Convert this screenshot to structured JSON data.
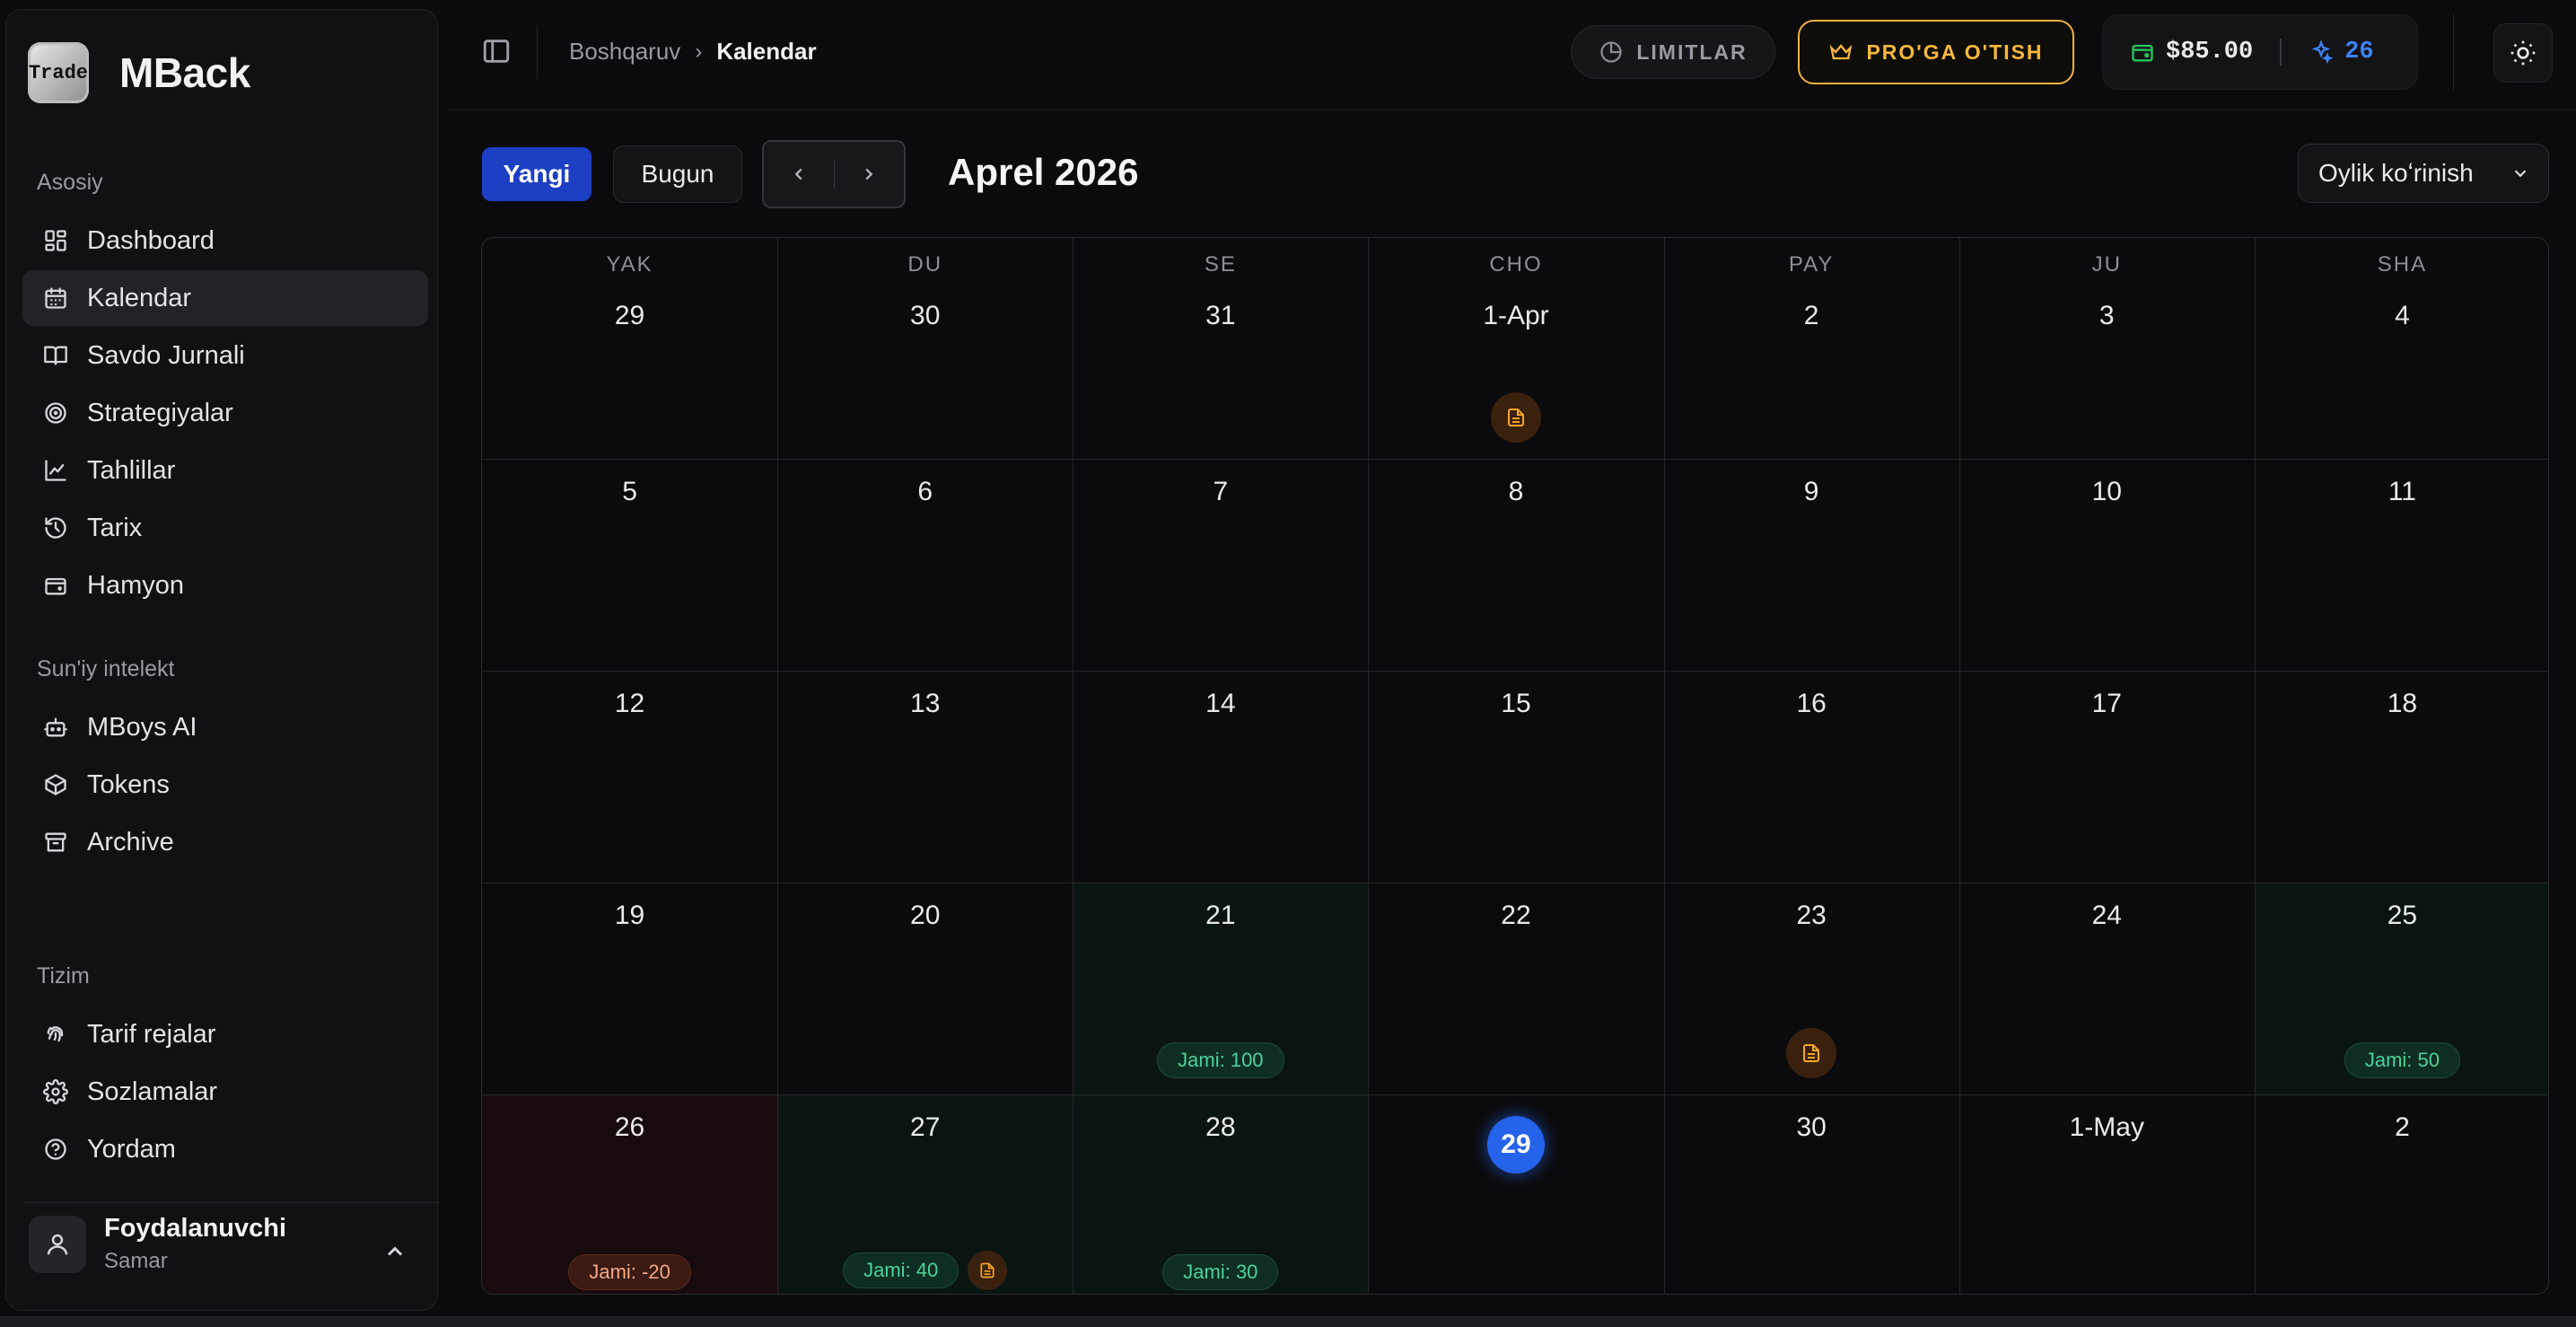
{
  "brand": {
    "logo_text": "Trade",
    "name": "MBack"
  },
  "sidebar": {
    "sections": [
      {
        "label": "Asosiy",
        "items": [
          {
            "label": "Dashboard",
            "icon": "grid-icon"
          },
          {
            "label": "Kalendar",
            "icon": "calendar-icon",
            "active": true
          },
          {
            "label": "Savdo Jurnali",
            "icon": "book-icon"
          },
          {
            "label": "Strategiyalar",
            "icon": "target-icon"
          },
          {
            "label": "Tahlillar",
            "icon": "chart-line-icon"
          },
          {
            "label": "Tarix",
            "icon": "history-icon"
          },
          {
            "label": "Hamyon",
            "icon": "wallet-icon"
          }
        ]
      },
      {
        "label": "Sun'iy intelekt",
        "items": [
          {
            "label": "MBoys AI",
            "icon": "bot-icon"
          },
          {
            "label": "Tokens",
            "icon": "box-icon"
          },
          {
            "label": "Archive",
            "icon": "archive-icon"
          }
        ]
      },
      {
        "label": "Tizim",
        "items": [
          {
            "label": "Tarif rejalar",
            "icon": "fingerprint-icon"
          },
          {
            "label": "Sozlamalar",
            "icon": "gear-icon"
          },
          {
            "label": "Yordam",
            "icon": "help-icon"
          }
        ]
      }
    ],
    "user": {
      "name": "Foydalanuvchi",
      "subtitle": "Samar"
    }
  },
  "topbar": {
    "breadcrumb": {
      "parent": "Boshqaruv",
      "current": "Kalendar"
    },
    "limits_label": "LIMITLAR",
    "pro_label": "PRO'GA O'TISH",
    "balance": "$85.00",
    "tokens": "26",
    "colors": {
      "pro": "#f5b83d",
      "token": "#3b82f6",
      "wallet": "#22c55e"
    }
  },
  "calendar": {
    "new_label": "Yangi",
    "today_label": "Bugun",
    "month_title": "Aprel 2026",
    "view_label": "Oylik koʻrinish",
    "weekdays": [
      "YAK",
      "DU",
      "SE",
      "CHO",
      "PAY",
      "JU",
      "SHA"
    ],
    "weeks": [
      [
        {
          "d": "29"
        },
        {
          "d": "30"
        },
        {
          "d": "31"
        },
        {
          "d": "1-Apr",
          "note": true
        },
        {
          "d": "2"
        },
        {
          "d": "3"
        },
        {
          "d": "4"
        }
      ],
      [
        {
          "d": "5"
        },
        {
          "d": "6"
        },
        {
          "d": "7"
        },
        {
          "d": "8"
        },
        {
          "d": "9"
        },
        {
          "d": "10"
        },
        {
          "d": "11"
        }
      ],
      [
        {
          "d": "12"
        },
        {
          "d": "13"
        },
        {
          "d": "14"
        },
        {
          "d": "15"
        },
        {
          "d": "16"
        },
        {
          "d": "17"
        },
        {
          "d": "18"
        }
      ],
      [
        {
          "d": "19"
        },
        {
          "d": "20"
        },
        {
          "d": "21",
          "tone": "green",
          "total": "Jami: 100"
        },
        {
          "d": "22"
        },
        {
          "d": "23",
          "note": true
        },
        {
          "d": "24"
        },
        {
          "d": "25",
          "tone": "green",
          "total": "Jami: 50"
        }
      ],
      [
        {
          "d": "26",
          "tone": "red",
          "total": "Jami: -20",
          "neg": true
        },
        {
          "d": "27",
          "tone": "green",
          "total": "Jami: 40",
          "note": true
        },
        {
          "d": "28",
          "tone": "green",
          "total": "Jami: 30"
        },
        {
          "d": "29",
          "today": true
        },
        {
          "d": "30"
        },
        {
          "d": "1-May"
        },
        {
          "d": "2"
        }
      ]
    ]
  }
}
